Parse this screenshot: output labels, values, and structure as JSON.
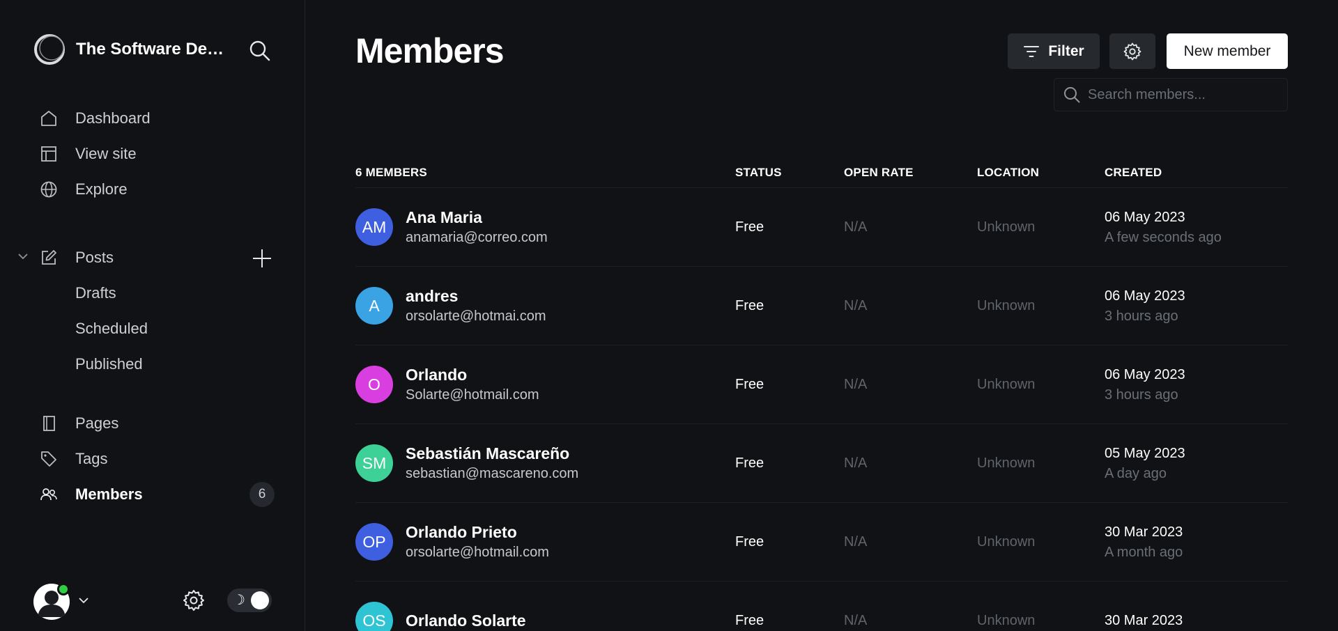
{
  "sidebar": {
    "brand_name": "The Software Desi...",
    "nav": [
      {
        "label": "Dashboard",
        "icon": "home-icon"
      },
      {
        "label": "View site",
        "icon": "layout-icon"
      },
      {
        "label": "Explore",
        "icon": "globe-icon"
      }
    ],
    "posts": {
      "label": "Posts",
      "sub": [
        "Drafts",
        "Scheduled",
        "Published"
      ]
    },
    "nav2": [
      {
        "label": "Pages",
        "icon": "pages-icon"
      },
      {
        "label": "Tags",
        "icon": "tag-icon"
      },
      {
        "label": "Members",
        "icon": "members-icon",
        "count": "6"
      }
    ],
    "theme_moon": "☽"
  },
  "header": {
    "title": "Members",
    "filter_label": "Filter",
    "new_member_label": "New member",
    "search_placeholder": "Search members..."
  },
  "table": {
    "headers": {
      "name": "6 MEMBERS",
      "status": "STATUS",
      "open_rate": "OPEN RATE",
      "location": "LOCATION",
      "created": "CREATED"
    },
    "rows": [
      {
        "initials": "AM",
        "color": "#3d5fe0",
        "name": "Ana Maria",
        "email": "anamaria@correo.com",
        "status": "Free",
        "open_rate": "N/A",
        "location": "Unknown",
        "created": "06 May 2023",
        "created_rel": "A few seconds ago"
      },
      {
        "initials": "A",
        "color": "#3aa3e3",
        "name": "andres",
        "email": "orsolarte@hotmai.com",
        "status": "Free",
        "open_rate": "N/A",
        "location": "Unknown",
        "created": "06 May 2023",
        "created_rel": "3 hours ago"
      },
      {
        "initials": "O",
        "color": "#d93ee0",
        "name": "Orlando",
        "email": "Solarte@hotmail.com",
        "status": "Free",
        "open_rate": "N/A",
        "location": "Unknown",
        "created": "06 May 2023",
        "created_rel": "3 hours ago"
      },
      {
        "initials": "SM",
        "color": "#3ed197",
        "name": "Sebastián Mascareño",
        "email": "sebastian@mascareno.com",
        "status": "Free",
        "open_rate": "N/A",
        "location": "Unknown",
        "created": "05 May 2023",
        "created_rel": "A day ago"
      },
      {
        "initials": "OP",
        "color": "#3d5fe0",
        "name": "Orlando Prieto",
        "email": "orsolarte@hotmail.com",
        "status": "Free",
        "open_rate": "N/A",
        "location": "Unknown",
        "created": "30 Mar 2023",
        "created_rel": "A month ago"
      },
      {
        "initials": "OS",
        "color": "#2fc4d4",
        "name": "Orlando Solarte",
        "email": "",
        "status": "Free",
        "open_rate": "N/A",
        "location": "Unknown",
        "created": "30 Mar 2023",
        "created_rel": ""
      }
    ]
  }
}
